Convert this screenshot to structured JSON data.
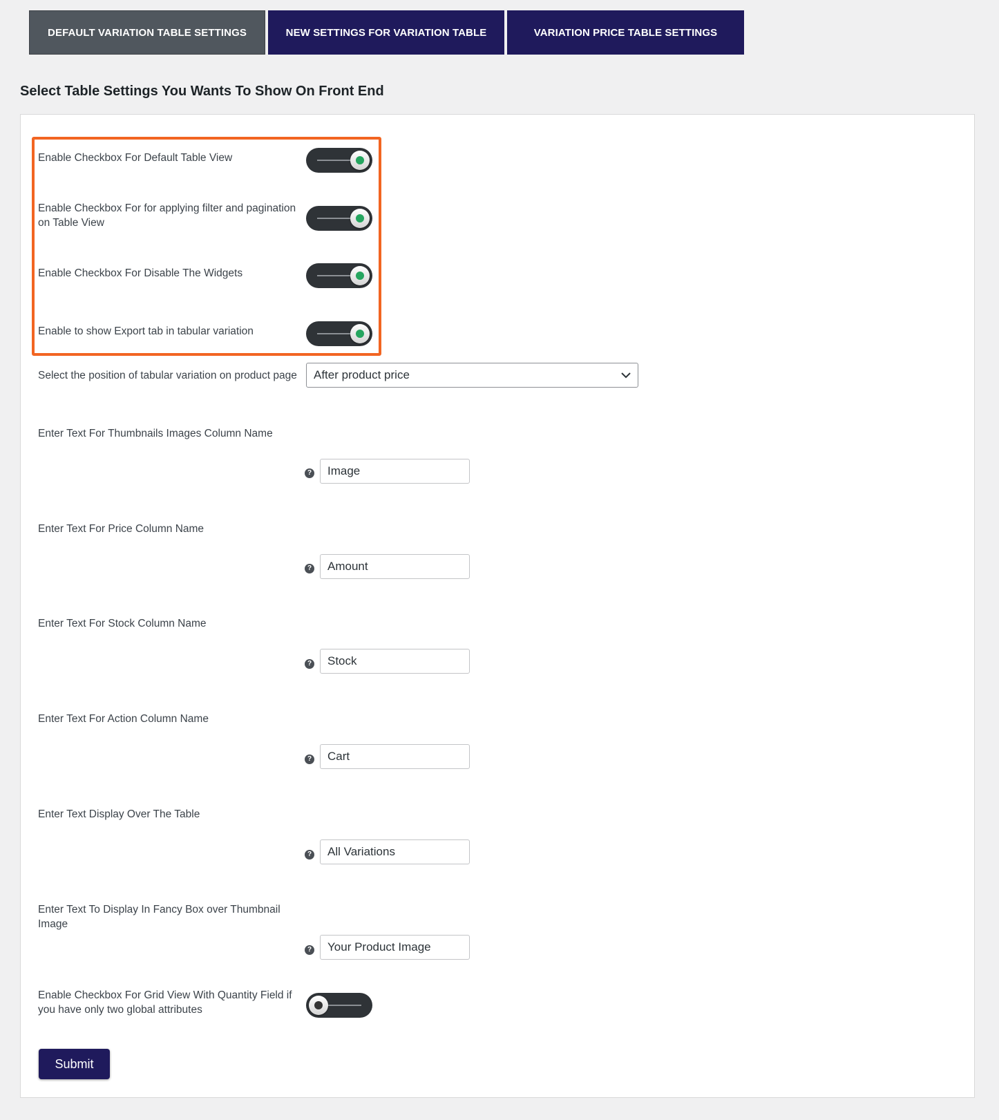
{
  "tabs": [
    {
      "label": "DEFAULT VARIATION TABLE SETTINGS"
    },
    {
      "label": "NEW SETTINGS FOR VARIATION TABLE"
    },
    {
      "label": "VARIATION PRICE TABLE SETTINGS"
    }
  ],
  "section_title": "Select Table Settings You Wants To Show On Front End",
  "toggles": [
    {
      "label": "Enable Checkbox For Default Table View",
      "on": true
    },
    {
      "label": "Enable Checkbox For for applying filter and pagination on Table View",
      "on": true
    },
    {
      "label": "Enable Checkbox For Disable The Widgets",
      "on": true
    },
    {
      "label": "Enable to show Export tab in tabular variation",
      "on": true
    }
  ],
  "position_select": {
    "label": "Select the position of tabular variation on product page",
    "value": "After product price"
  },
  "text_fields": [
    {
      "label": "Enter Text For Thumbnails Images Column Name",
      "value": "Image"
    },
    {
      "label": "Enter Text For Price Column Name",
      "value": "Amount"
    },
    {
      "label": "Enter Text For Stock Column Name",
      "value": "Stock"
    },
    {
      "label": "Enter Text For Action Column Name",
      "value": "Cart"
    },
    {
      "label": "Enter Text Display Over The Table",
      "value": "All Variations"
    },
    {
      "label": "Enter Text To Display In Fancy Box over Thumbnail Image",
      "value": "Your Product Image"
    }
  ],
  "grid_toggle": {
    "label": "Enable Checkbox For Grid View With Quantity Field if you have only two global attributes",
    "on": false
  },
  "help_glyph": "?",
  "submit_label": "Submit",
  "colors": {
    "active_tab": "#50575e",
    "tab": "#1f1a5c",
    "highlight": "#f26522",
    "toggle_on_dot": "#25a55f"
  }
}
